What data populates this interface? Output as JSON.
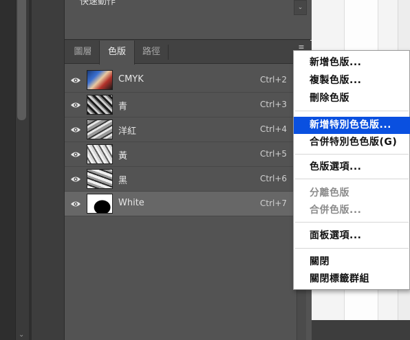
{
  "actions_panel": {
    "title": "快速動作"
  },
  "tabs": [
    {
      "label": "圖層",
      "active": false
    },
    {
      "label": "色版",
      "active": true
    },
    {
      "label": "路徑",
      "active": false
    }
  ],
  "channels": [
    {
      "name": "CMYK",
      "shortcut": "Ctrl+2",
      "selected": false
    },
    {
      "name": "青",
      "shortcut": "Ctrl+3",
      "selected": false
    },
    {
      "name": "洋紅",
      "shortcut": "Ctrl+4",
      "selected": false
    },
    {
      "name": "黃",
      "shortcut": "Ctrl+5",
      "selected": false
    },
    {
      "name": "黑",
      "shortcut": "Ctrl+6",
      "selected": false
    },
    {
      "name": "White",
      "shortcut": "Ctrl+7",
      "selected": true
    }
  ],
  "context_menu": {
    "items": [
      {
        "label": "新增色版...",
        "state": "enabled"
      },
      {
        "label": "複製色版...",
        "state": "enabled"
      },
      {
        "label": "刪除色版",
        "state": "enabled"
      },
      {
        "label": "新增特別色色版...",
        "state": "highlighted"
      },
      {
        "label": "合併特別色色版(G)",
        "state": "enabled"
      },
      {
        "label": "色版選項...",
        "state": "enabled"
      },
      {
        "label": "分離色版",
        "state": "disabled"
      },
      {
        "label": "合併色版...",
        "state": "disabled"
      },
      {
        "label": "面板選項...",
        "state": "enabled"
      },
      {
        "label": "關閉",
        "state": "enabled"
      },
      {
        "label": "關閉標籤群組",
        "state": "enabled"
      }
    ]
  },
  "colors": {
    "panel_bg": "#535353",
    "selected_row": "#676767",
    "menu_highlight": "#0a50e0"
  }
}
